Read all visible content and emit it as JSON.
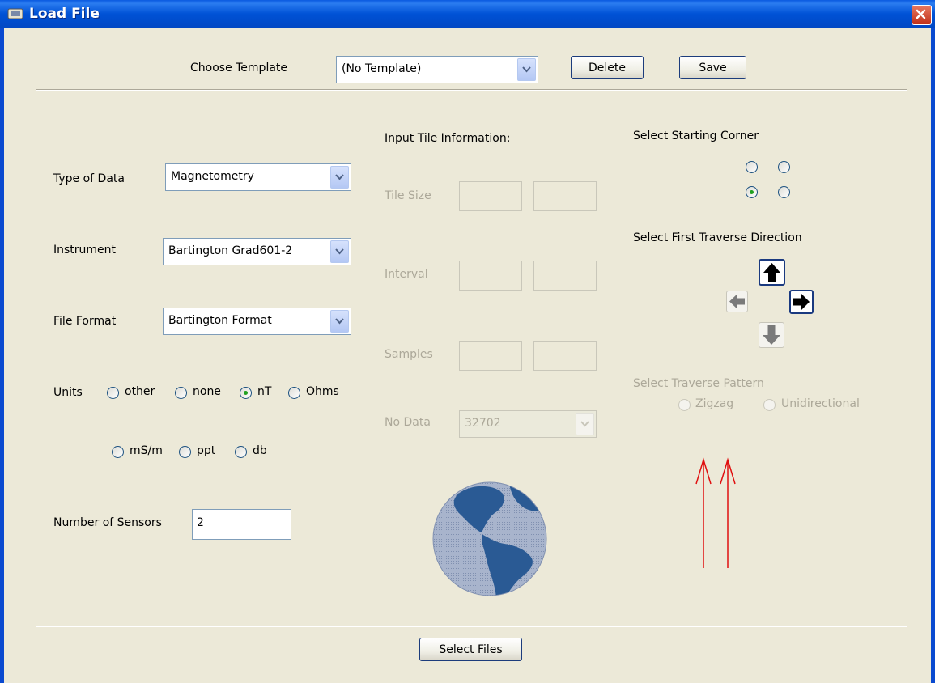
{
  "window": {
    "title": "Load File",
    "icon": "java-cup-icon",
    "close_icon": "close-icon"
  },
  "template": {
    "label": "Choose Template",
    "selected": "(No Template)",
    "delete_label": "Delete",
    "save_label": "Save"
  },
  "form": {
    "type_of_data": {
      "label": "Type of Data",
      "selected": "Magnetometry"
    },
    "instrument": {
      "label": "Instrument",
      "selected": "Bartington Grad601-2"
    },
    "file_format": {
      "label": "File Format",
      "selected": "Bartington Format"
    },
    "units": {
      "label": "Units",
      "options": [
        "other",
        "none",
        "nT",
        "Ohms",
        "mS/m",
        "ppt",
        "db"
      ],
      "selected": "nT"
    },
    "sensors": {
      "label": "Number of Sensors",
      "value": "2"
    }
  },
  "tile": {
    "heading": "Input Tile Information:",
    "tile_size_label": "Tile Size",
    "interval_label": "Interval",
    "samples_label": "Samples",
    "no_data_label": "No Data",
    "no_data_value": "32702"
  },
  "corner": {
    "heading": "Select Starting Corner",
    "selected_position": "bottom-left"
  },
  "traverse": {
    "heading": "Select First Traverse Direction",
    "selected_direction": "up"
  },
  "pattern": {
    "heading": "Select Traverse Pattern",
    "zigzag_label": "Zigzag",
    "unidirectional_label": "Unidirectional"
  },
  "footer": {
    "select_files_label": "Select Files"
  },
  "colors": {
    "title_bar": "#0052d6",
    "dialog_bg": "#ece9d8",
    "arrow_line": "#e01010",
    "globe": "#2a5a94"
  }
}
